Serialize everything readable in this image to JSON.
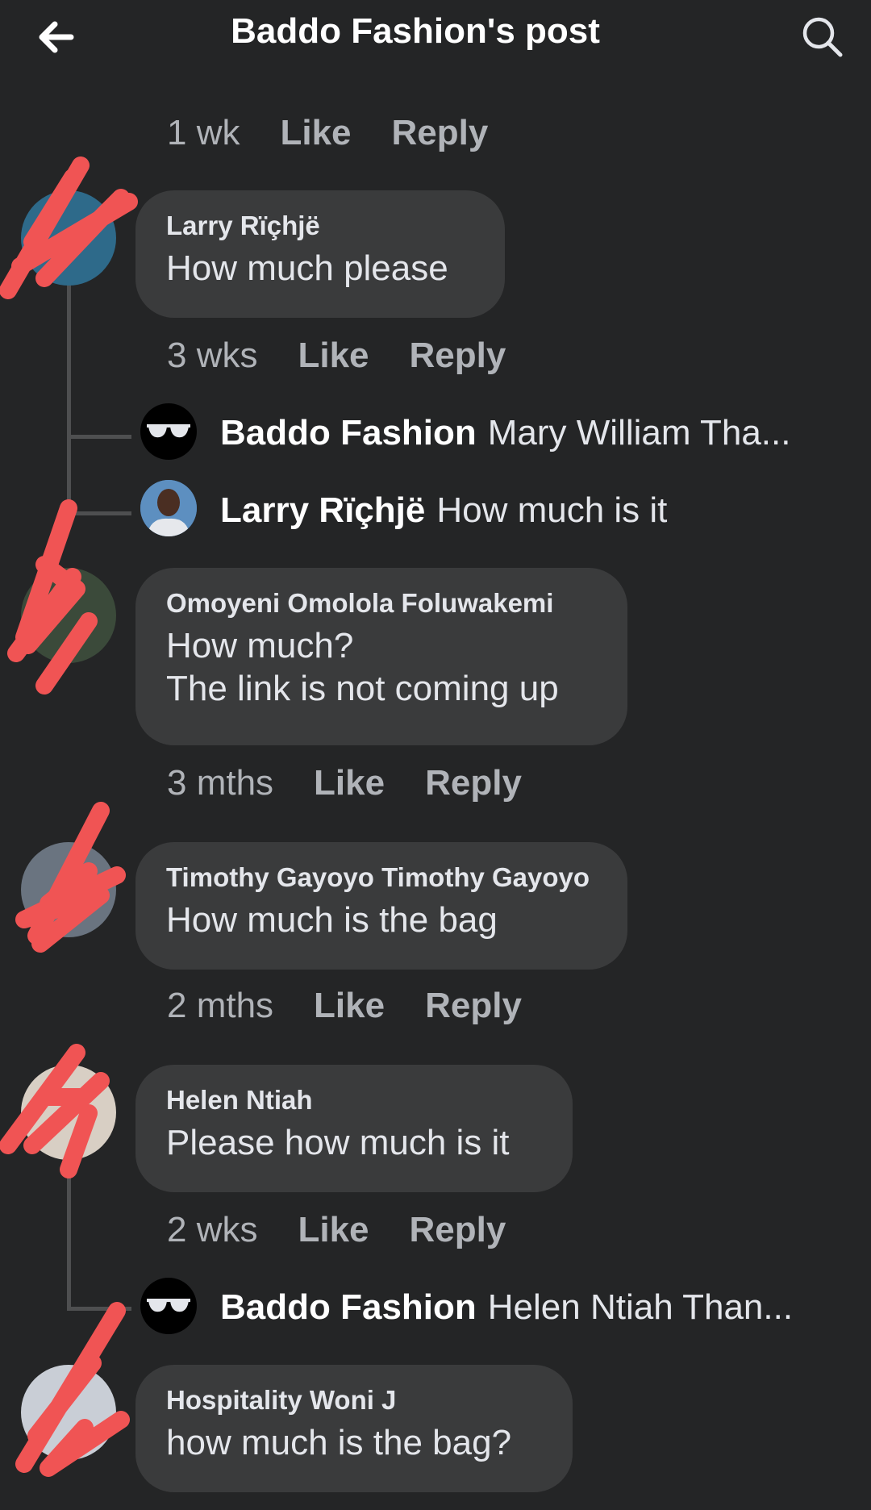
{
  "header": {
    "title": "Baddo Fashion's post"
  },
  "top_meta": {
    "time": "1 wk",
    "like": "Like",
    "reply": "Reply"
  },
  "comments": [
    {
      "name": "Larry Rïçhjë",
      "text": "How much please",
      "time": "3 wks",
      "like": "Like",
      "reply": "Reply"
    },
    {
      "name": "Omoyeni Omolola Foluwakemi",
      "text": "How much?\nThe link is not coming up",
      "time": "3 mths",
      "like": "Like",
      "reply": "Reply"
    },
    {
      "name": "Timothy Gayoyo Timothy Gayoyo",
      "text": "How much is the bag",
      "time": "2 mths",
      "like": "Like",
      "reply": "Reply"
    },
    {
      "name": "Helen Ntiah",
      "text": "Please how much is it",
      "time": "2 wks",
      "like": "Like",
      "reply": "Reply"
    },
    {
      "name": "Hospitality Woni J",
      "text": "how much is the bag?"
    }
  ],
  "replies": [
    {
      "name": "Baddo Fashion",
      "text": "Mary William Tha..."
    },
    {
      "name": "Larry Rïçhjë",
      "text": "How much is it"
    },
    {
      "name": "Baddo Fashion",
      "text": "Helen Ntiah Than..."
    }
  ],
  "colors": {
    "background": "#242526",
    "bubble": "#3a3b3c",
    "meta_text": "#b0b3b8",
    "redaction": "#f05454"
  },
  "icons": {
    "back": "arrow-left-icon",
    "search": "search-icon"
  }
}
